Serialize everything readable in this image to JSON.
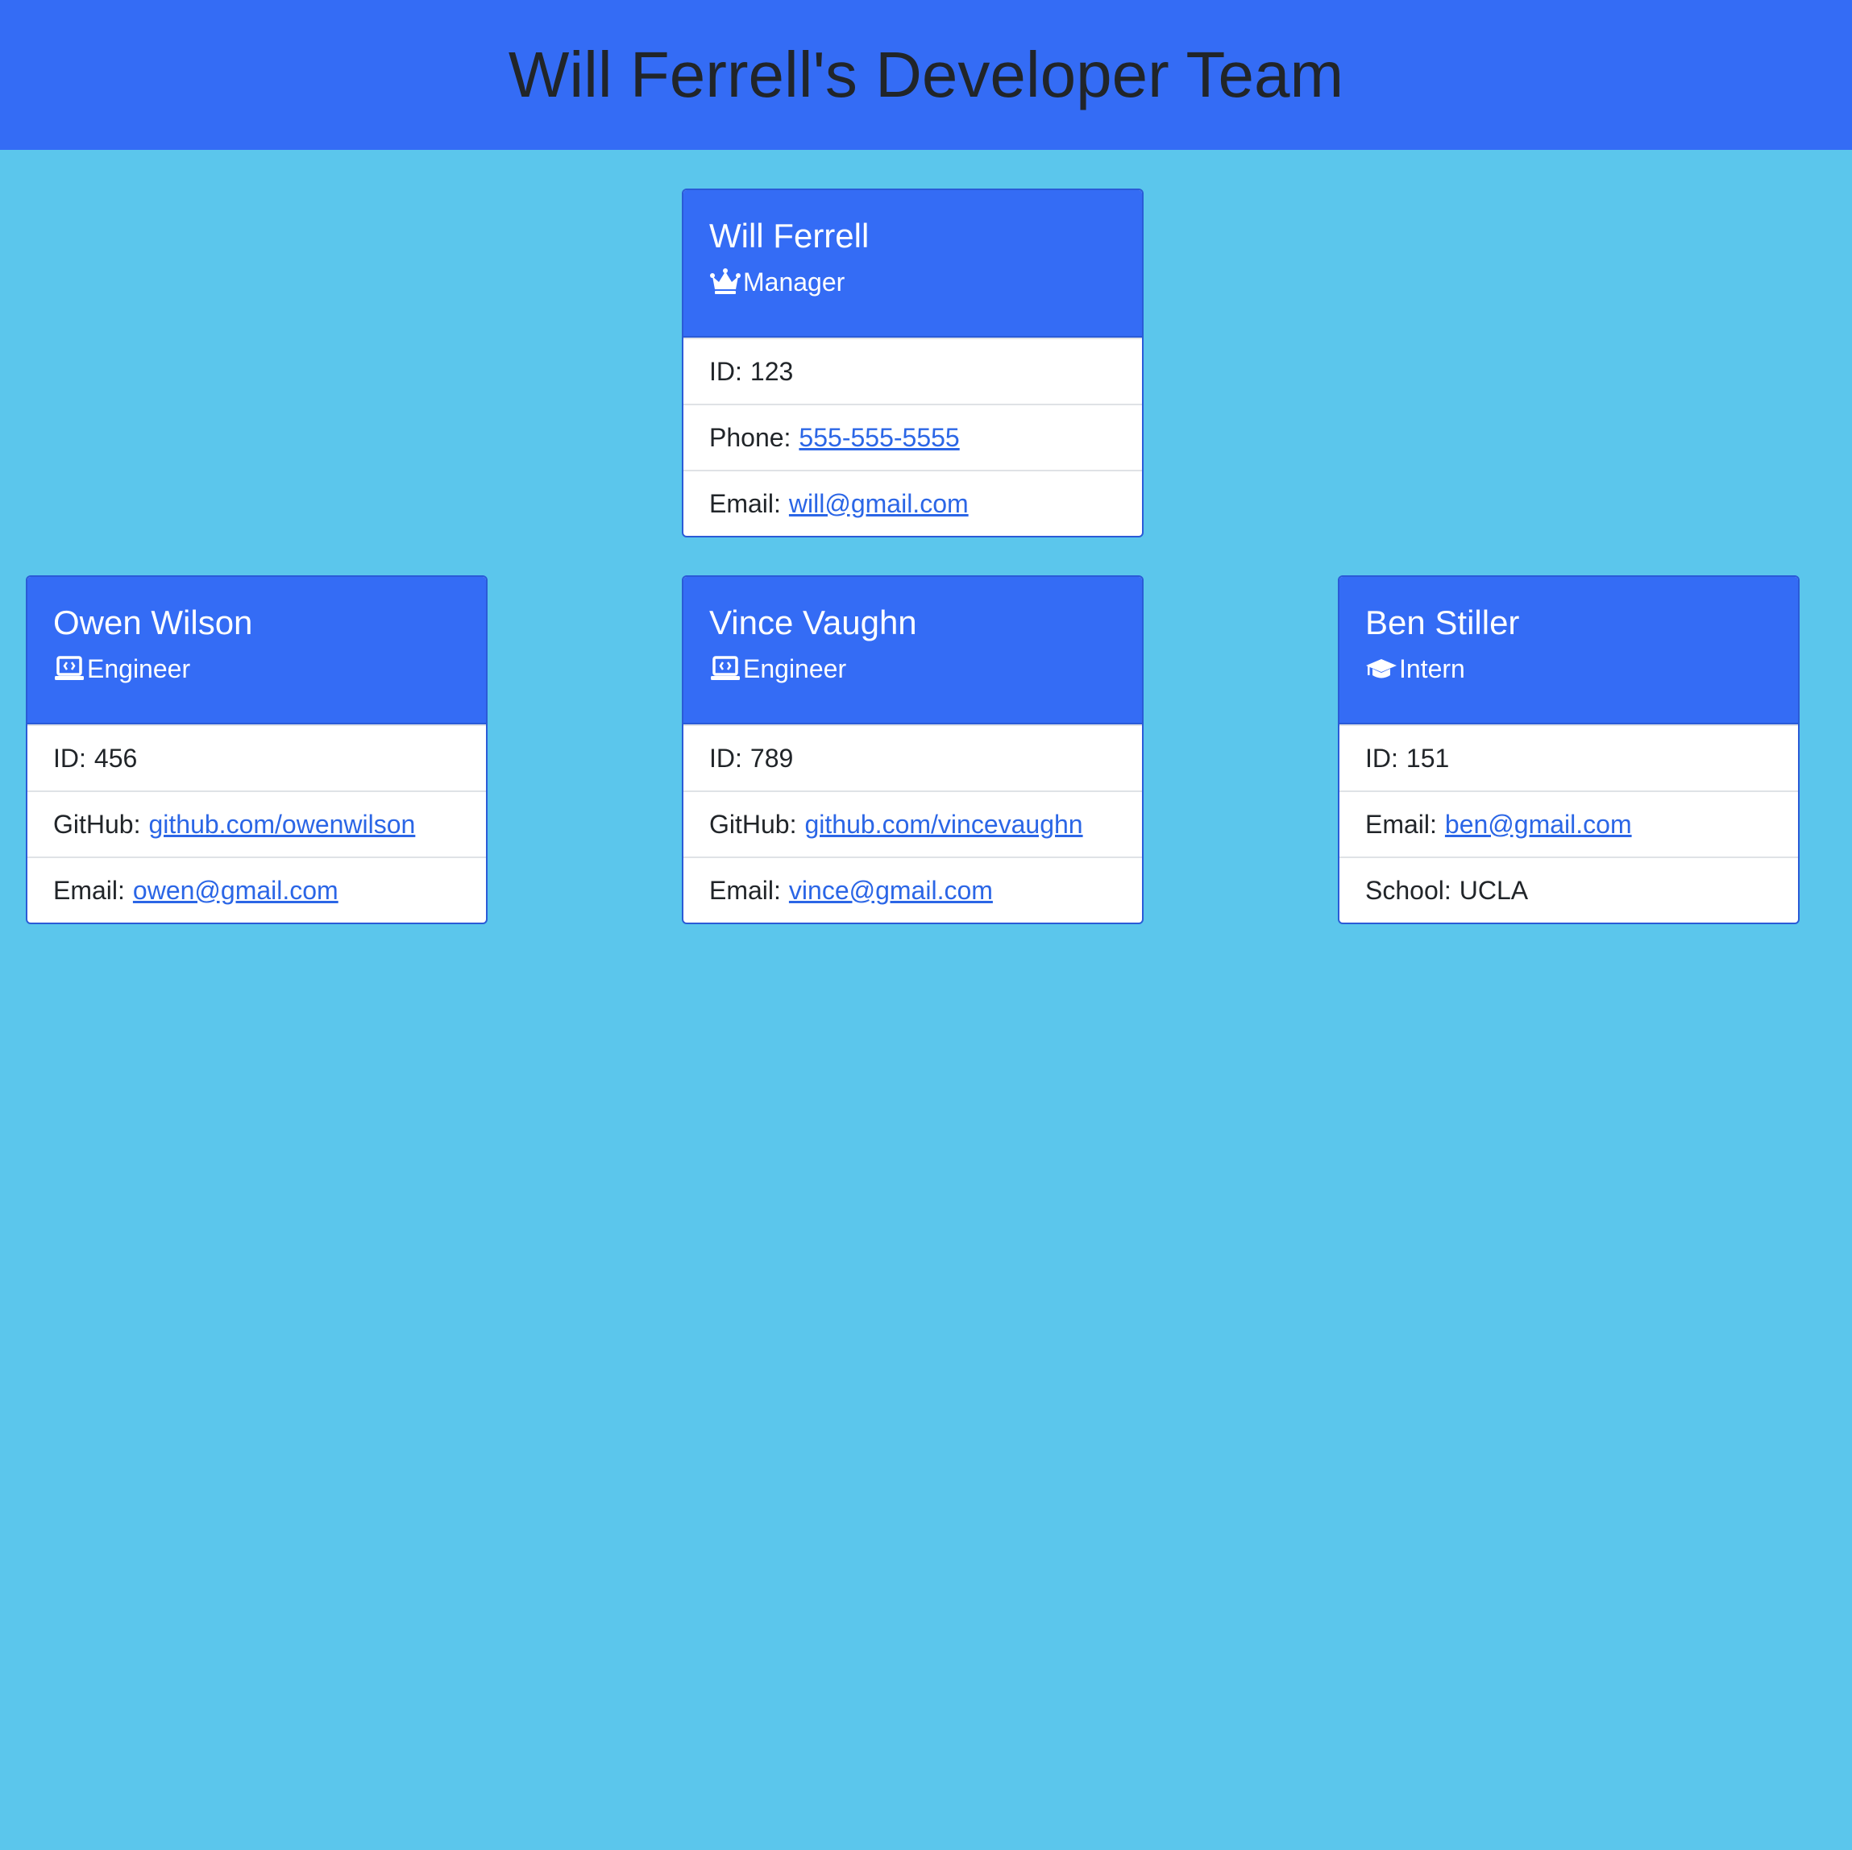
{
  "page": {
    "title": "Will Ferrell's Developer Team"
  },
  "colors": {
    "background": "#5bc6ec",
    "banner": "#346cf5",
    "card_header": "#346cf5",
    "link": "#2b66e6"
  },
  "cards": [
    {
      "name": "Will Ferrell",
      "role": "Manager",
      "role_icon": "crown-icon",
      "id_label": "ID:",
      "id": "123",
      "field2_label": "Phone:",
      "field2_value": "555-555-5555",
      "field3_label": "Email:",
      "field3_value": "will@gmail.com"
    },
    {
      "name": "Owen Wilson",
      "role": "Engineer",
      "role_icon": "laptop-code-icon",
      "id_label": "ID:",
      "id": "456",
      "field2_label": "GitHub:",
      "field2_value": "github.com/owenwilson",
      "field3_label": "Email:",
      "field3_value": "owen@gmail.com"
    },
    {
      "name": "Vince Vaughn",
      "role": "Engineer",
      "role_icon": "laptop-code-icon",
      "id_label": "ID:",
      "id": "789",
      "field2_label": "GitHub:",
      "field2_value": "github.com/vincevaughn",
      "field3_label": "Email:",
      "field3_value": "vince@gmail.com"
    },
    {
      "name": "Ben Stiller",
      "role": "Intern",
      "role_icon": "graduation-cap-icon",
      "id_label": "ID:",
      "id": "151",
      "field2_label": "Email:",
      "field2_value": "ben@gmail.com",
      "field3_label": "School:",
      "field3_value": "UCLA"
    }
  ]
}
